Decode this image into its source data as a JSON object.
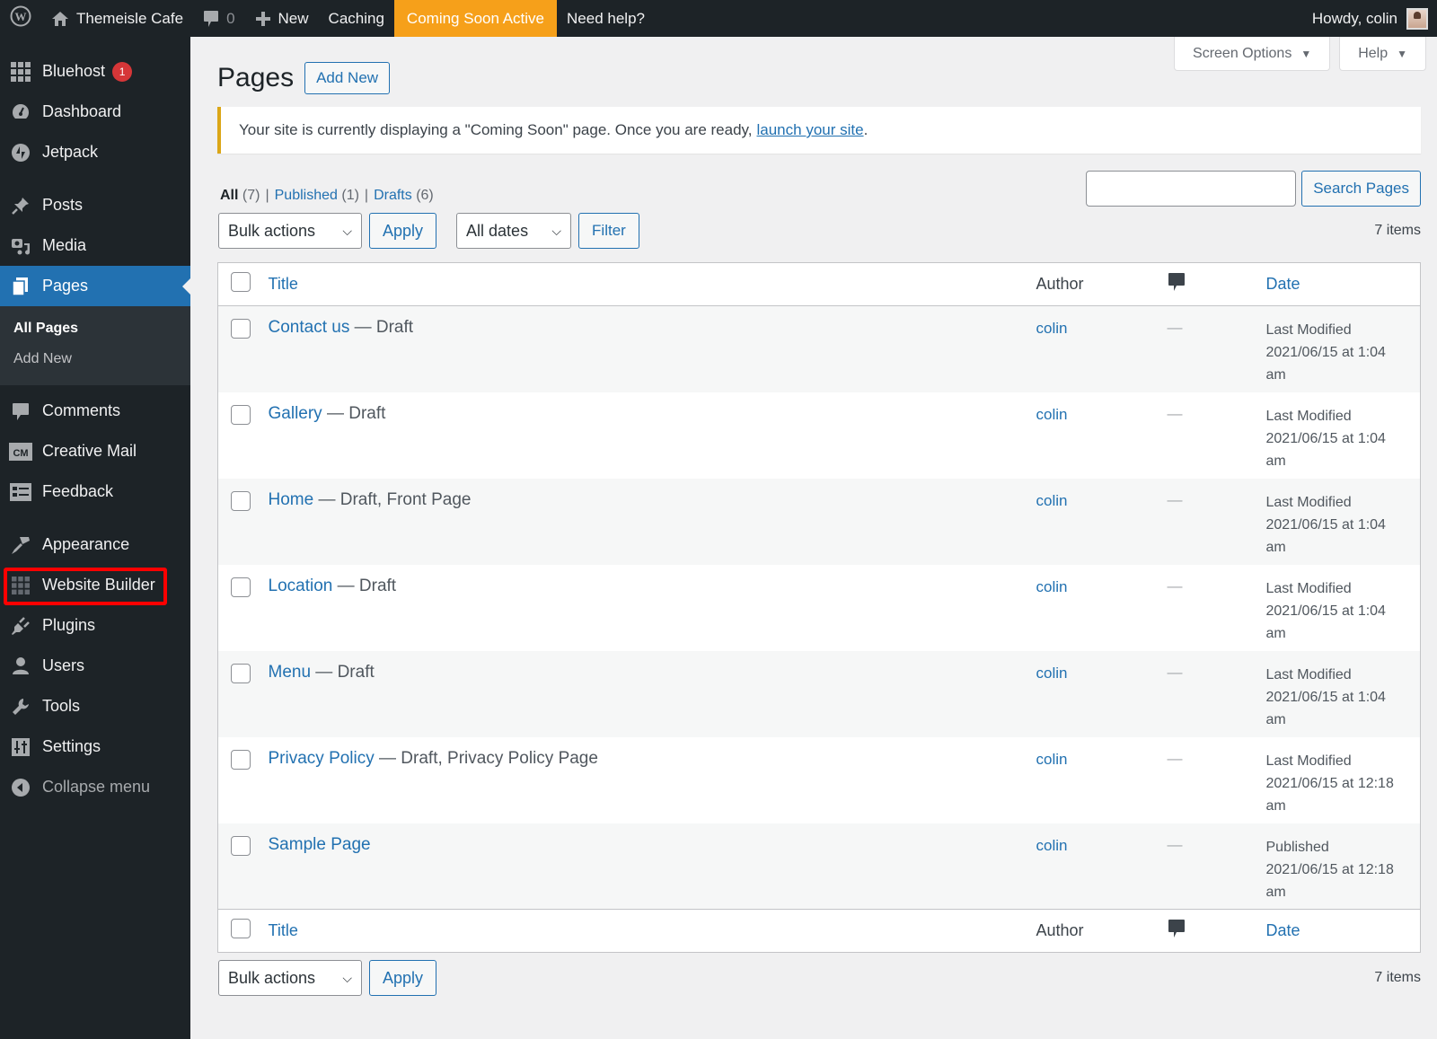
{
  "adminbar": {
    "wp_logo": "wordpress-logo",
    "site_name": "Themeisle Cafe",
    "comments_count": "0",
    "new_label": "New",
    "caching_label": "Caching",
    "coming_soon_label": "Coming Soon Active",
    "help_label": "Need help?",
    "greeting": "Howdy, colin",
    "accent_color": "#f6a01a"
  },
  "sidebar": {
    "items": [
      {
        "label": "Bluehost",
        "icon": "grid-icon",
        "badge": "1"
      },
      {
        "label": "Dashboard",
        "icon": "dashboard-icon"
      },
      {
        "label": "Jetpack",
        "icon": "jetpack-icon"
      },
      {
        "label": "Posts",
        "icon": "pin-icon"
      },
      {
        "label": "Media",
        "icon": "media-icon"
      },
      {
        "label": "Pages",
        "icon": "pages-icon",
        "current": true
      },
      {
        "label": "Comments",
        "icon": "comment-icon"
      },
      {
        "label": "Creative Mail",
        "icon": "cm-icon"
      },
      {
        "label": "Feedback",
        "icon": "feedback-icon"
      },
      {
        "label": "Appearance",
        "icon": "brush-icon"
      },
      {
        "label": "Website Builder",
        "icon": "grid-icon",
        "highlighted": true
      },
      {
        "label": "Plugins",
        "icon": "plug-icon"
      },
      {
        "label": "Users",
        "icon": "user-icon"
      },
      {
        "label": "Tools",
        "icon": "wrench-icon"
      },
      {
        "label": "Settings",
        "icon": "settings-icon"
      },
      {
        "label": "Collapse menu",
        "icon": "collapse-icon"
      }
    ],
    "submenu": {
      "all_pages": "All Pages",
      "add_new": "Add New"
    },
    "current_color": "#2271b1",
    "highlight_color": "#ff0000"
  },
  "screen_meta": {
    "screen_options": "Screen Options",
    "help": "Help"
  },
  "page": {
    "title": "Pages",
    "add_new": "Add New",
    "notice_text": "Your site is currently displaying a \"Coming Soon\" page. Once you are ready,",
    "notice_link": "launch your site",
    "notice_end": "."
  },
  "filters": {
    "all": "All",
    "all_count": "(7)",
    "published": "Published",
    "published_count": "(1)",
    "drafts": "Drafts",
    "drafts_count": "(6)",
    "sep": "|"
  },
  "search": {
    "value": "",
    "button": "Search Pages"
  },
  "tablenav": {
    "bulk_actions": "Bulk actions",
    "apply": "Apply",
    "dates": "All dates",
    "filter": "Filter",
    "items": "7 items"
  },
  "table": {
    "columns": {
      "title": "Title",
      "author": "Author",
      "date": "Date"
    },
    "rows": [
      {
        "title": "Contact us",
        "state": " — Draft",
        "author": "colin",
        "comments": "—",
        "date_status": "Last Modified",
        "date": "2021/06/15 at 1:04",
        "ampm": "am"
      },
      {
        "title": "Gallery",
        "state": " — Draft",
        "author": "colin",
        "comments": "—",
        "date_status": "Last Modified",
        "date": "2021/06/15 at 1:04",
        "ampm": "am"
      },
      {
        "title": "Home",
        "state": " — Draft, Front Page",
        "author": "colin",
        "comments": "—",
        "date_status": "Last Modified",
        "date": "2021/06/15 at 1:04",
        "ampm": "am"
      },
      {
        "title": "Location",
        "state": " — Draft",
        "author": "colin",
        "comments": "—",
        "date_status": "Last Modified",
        "date": "2021/06/15 at 1:04",
        "ampm": "am"
      },
      {
        "title": "Menu",
        "state": " — Draft",
        "author": "colin",
        "comments": "—",
        "date_status": "Last Modified",
        "date": "2021/06/15 at 1:04",
        "ampm": "am"
      },
      {
        "title": "Privacy Policy",
        "state": " — Draft, Privacy Policy Page",
        "author": "colin",
        "comments": "—",
        "date_status": "Last Modified",
        "date": "2021/06/15 at 12:18",
        "ampm": "am"
      },
      {
        "title": "Sample Page",
        "state": "",
        "author": "colin",
        "comments": "—",
        "date_status": "Published",
        "date": "2021/06/15 at 12:18",
        "ampm": "am"
      }
    ]
  }
}
